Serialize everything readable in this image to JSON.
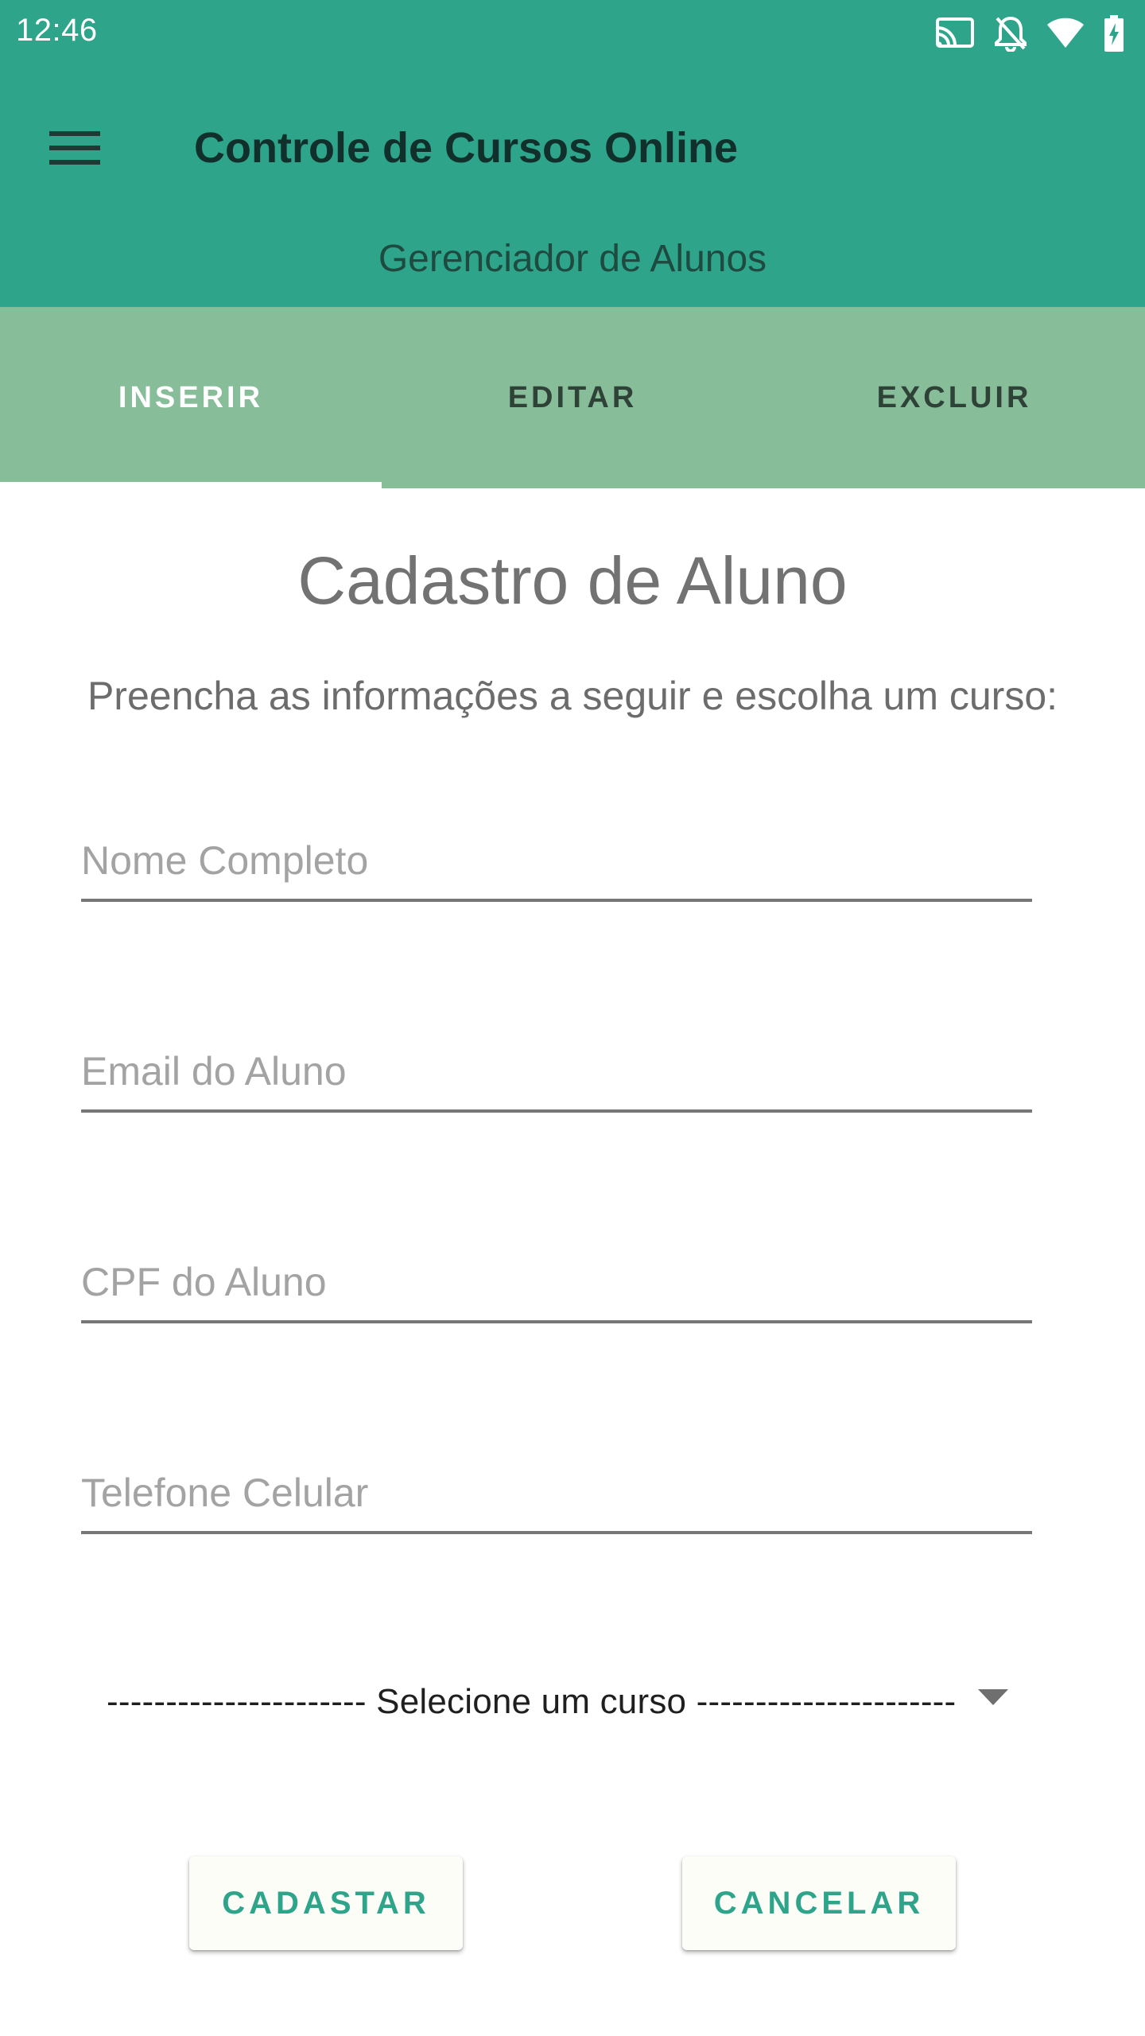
{
  "status_bar": {
    "time": "12:46",
    "icons": [
      "cast-icon",
      "notifications-off-icon",
      "wifi-icon",
      "battery-charging-icon"
    ]
  },
  "app_bar": {
    "menu_icon": "hamburger-menu-icon",
    "title": "Controle de Cursos Online",
    "subtitle": "Gerenciador de Alunos",
    "background_color": "#2ea58b"
  },
  "tabs": {
    "items": [
      {
        "label": "INSERIR",
        "active": true
      },
      {
        "label": "EDITAR",
        "active": false
      },
      {
        "label": "EXCLUIR",
        "active": false
      }
    ],
    "background_color": "#88bd9a"
  },
  "form": {
    "title": "Cadastro de Aluno",
    "instructions": "Preencha as informações a seguir e escolha um curso:",
    "fields": {
      "full_name": {
        "placeholder": "Nome Completo",
        "value": ""
      },
      "email": {
        "placeholder": "Email do Aluno",
        "value": ""
      },
      "cpf": {
        "placeholder": "CPF do Aluno",
        "value": ""
      },
      "phone": {
        "placeholder": "Telefone Celular",
        "value": ""
      }
    },
    "course_select": {
      "selected": "---------------------- Selecione um curso ----------------------",
      "icon": "dropdown-arrow-icon"
    },
    "buttons": {
      "submit_label": "CADASTAR",
      "cancel_label": "CANCELAR"
    },
    "accent_color": "#2ea58b"
  }
}
